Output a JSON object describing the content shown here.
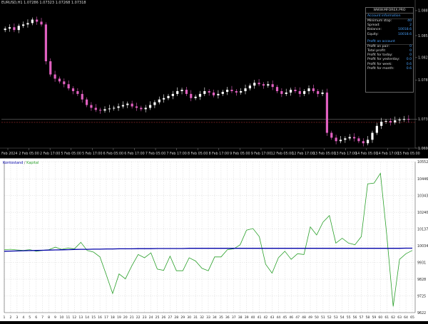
{
  "top_chart": {
    "info": "EURUSD,H1  1.07286 1.07323 1.07268 1.07318",
    "y_labels": [
      "1.08879",
      "1.08520",
      "1.08203",
      "1.07880",
      "1.07318",
      "1.06900"
    ],
    "x_labels": [
      "1 Feb 2024",
      "2 Feb 05:00",
      "2 Feb 17:00",
      "5 Feb 05:00",
      "5 Feb 17:00",
      "6 Feb 05:00",
      "6 Feb 17:00",
      "7 Feb 05:00",
      "7 Feb 17:00",
      "8 Feb 05:00",
      "8 Feb 17:00",
      "9 Feb 05:00",
      "9 Feb 17:00",
      "12 Feb 05:00",
      "12 Feb 17:00",
      "13 Feb 05:00",
      "13 Feb 17:00",
      "14 Feb 05:00",
      "14 Feb 17:00",
      "15 Feb 05:00"
    ],
    "closes": [
      1.0862,
      1.0864,
      1.086,
      1.0866,
      1.0868,
      1.087,
      1.0875,
      1.0872,
      1.0868,
      1.0815,
      1.0796,
      1.079,
      1.0786,
      1.0782,
      1.0776,
      1.0772,
      1.0768,
      1.076,
      1.0752,
      1.0748,
      1.0745,
      1.0744,
      1.0746,
      1.0747,
      1.0748,
      1.075,
      1.0752,
      1.0754,
      1.075,
      1.0748,
      1.0746,
      1.0748,
      1.0752,
      1.0756,
      1.076,
      1.0762,
      1.0765,
      1.0768,
      1.0772,
      1.0774,
      1.0768,
      1.0762,
      1.0764,
      1.0768,
      1.0772,
      1.077,
      1.0766,
      1.0768,
      1.0771,
      1.0774,
      1.0772,
      1.077,
      1.0772,
      1.0776,
      1.078,
      1.0784,
      1.0782,
      1.078,
      1.0782,
      1.0778,
      1.0772,
      1.0768,
      1.077,
      1.0774,
      1.0772,
      1.0768,
      1.0772,
      1.0776,
      1.0772,
      1.0768,
      1.077,
      1.0712,
      1.0705,
      1.07,
      1.0702,
      1.0704,
      1.0706,
      1.0704,
      1.07,
      1.0697,
      1.0702,
      1.0712,
      1.0722,
      1.0728,
      1.0729,
      1.0727,
      1.073,
      1.0731,
      1.0732,
      1.0731
    ],
    "bid_line": 1.07318,
    "red_line": 1.0727,
    "y_range": [
      1.069,
      1.0895
    ],
    "colors": {
      "bull": "#ffffff",
      "bear": "#e060c0",
      "grid": "#444444",
      "bid": "#888888",
      "red": "#c83232"
    }
  },
  "account_panel": {
    "header": "WWW.MFOREX.PRO",
    "account_title": "Account information",
    "account_rows": [
      {
        "label": "Minimum stop:",
        "value": "40"
      },
      {
        "label": "Spread:",
        "value": "2"
      },
      {
        "label": "Balance:",
        "value": "10018.6"
      },
      {
        "label": "Equity:",
        "value": "10018.6"
      }
    ],
    "profit_title": "Profit on account",
    "profit_rows": [
      {
        "label": "Profit on pair:",
        "value": "0"
      },
      {
        "label": "Total profit:",
        "value": "0"
      },
      {
        "label": "Profit for today:",
        "value": "0"
      },
      {
        "label": "Profit for yesterday:",
        "value": "0.0"
      },
      {
        "label": "Profit for week:",
        "value": "0.6"
      },
      {
        "label": "Profit for month:",
        "value": "0.6"
      }
    ]
  },
  "bottom_chart": {
    "legend_kontostand": "Kontostand",
    "legend_sep": "/",
    "legend_kapital": "Kapital",
    "y_labels": [
      "10552",
      "10446",
      "10343",
      "10240",
      "10137",
      "10034",
      "9931",
      "9828",
      "9725",
      "9622"
    ],
    "y_range": [
      9622,
      10552
    ],
    "x_labels": [
      "1",
      "2",
      "3",
      "4",
      "5",
      "6",
      "7",
      "8",
      "9",
      "10",
      "11",
      "12",
      "13",
      "14",
      "15",
      "16",
      "17",
      "18",
      "19",
      "20",
      "21",
      "22",
      "23",
      "24",
      "25",
      "26",
      "27",
      "28",
      "29",
      "30",
      "31",
      "32",
      "33",
      "34",
      "35",
      "36",
      "37",
      "38",
      "39",
      "40",
      "41",
      "42",
      "43",
      "44",
      "45",
      "46",
      "47",
      "48",
      "49",
      "50",
      "51",
      "52",
      "53",
      "54",
      "55",
      "56",
      "57",
      "58",
      "59",
      "60",
      "61",
      "62",
      "63",
      "64",
      "65"
    ],
    "kapital": [
      10010,
      10012,
      10008,
      10005,
      10010,
      10000,
      10005,
      10010,
      10025,
      10012,
      10020,
      10015,
      10055,
      10005,
      9995,
      9965,
      9855,
      9740,
      9860,
      9830,
      9910,
      9980,
      9960,
      9990,
      9890,
      9882,
      9970,
      9880,
      9880,
      9960,
      9940,
      9895,
      9880,
      9965,
      9965,
      10010,
      10015,
      10040,
      10130,
      10140,
      10090,
      9920,
      9865,
      9960,
      10000,
      9950,
      9985,
      9980,
      10150,
      10100,
      10180,
      10220,
      10050,
      10080,
      10050,
      10040,
      10090,
      10415,
      10420,
      10480,
      10095,
      9660,
      9950,
      9985,
      10005
    ],
    "kontostand": [
      10000,
      10001,
      10002,
      10003,
      10004,
      10005,
      10006,
      10007,
      10008,
      10009,
      10010,
      10011,
      10012,
      10012,
      10013,
      10013,
      10014,
      10014,
      10015,
      10015,
      10015,
      10016,
      10016,
      10016,
      10017,
      10017,
      10017,
      10017,
      10017,
      10018,
      10018,
      10018,
      10018,
      10018,
      10018,
      10018,
      10018,
      10018,
      10018,
      10018,
      10018,
      10018,
      10018,
      10018,
      10018,
      10018,
      10018,
      10018,
      10018,
      10018,
      10018,
      10018,
      10018,
      10018,
      10018,
      10018,
      10018,
      10018,
      10018,
      10018,
      10018,
      10018,
      10018,
      10019,
      10019
    ],
    "colors": {
      "kapital": "#2aa02a",
      "kontostand": "#0000a8",
      "grid": "#d8d8d8"
    }
  }
}
